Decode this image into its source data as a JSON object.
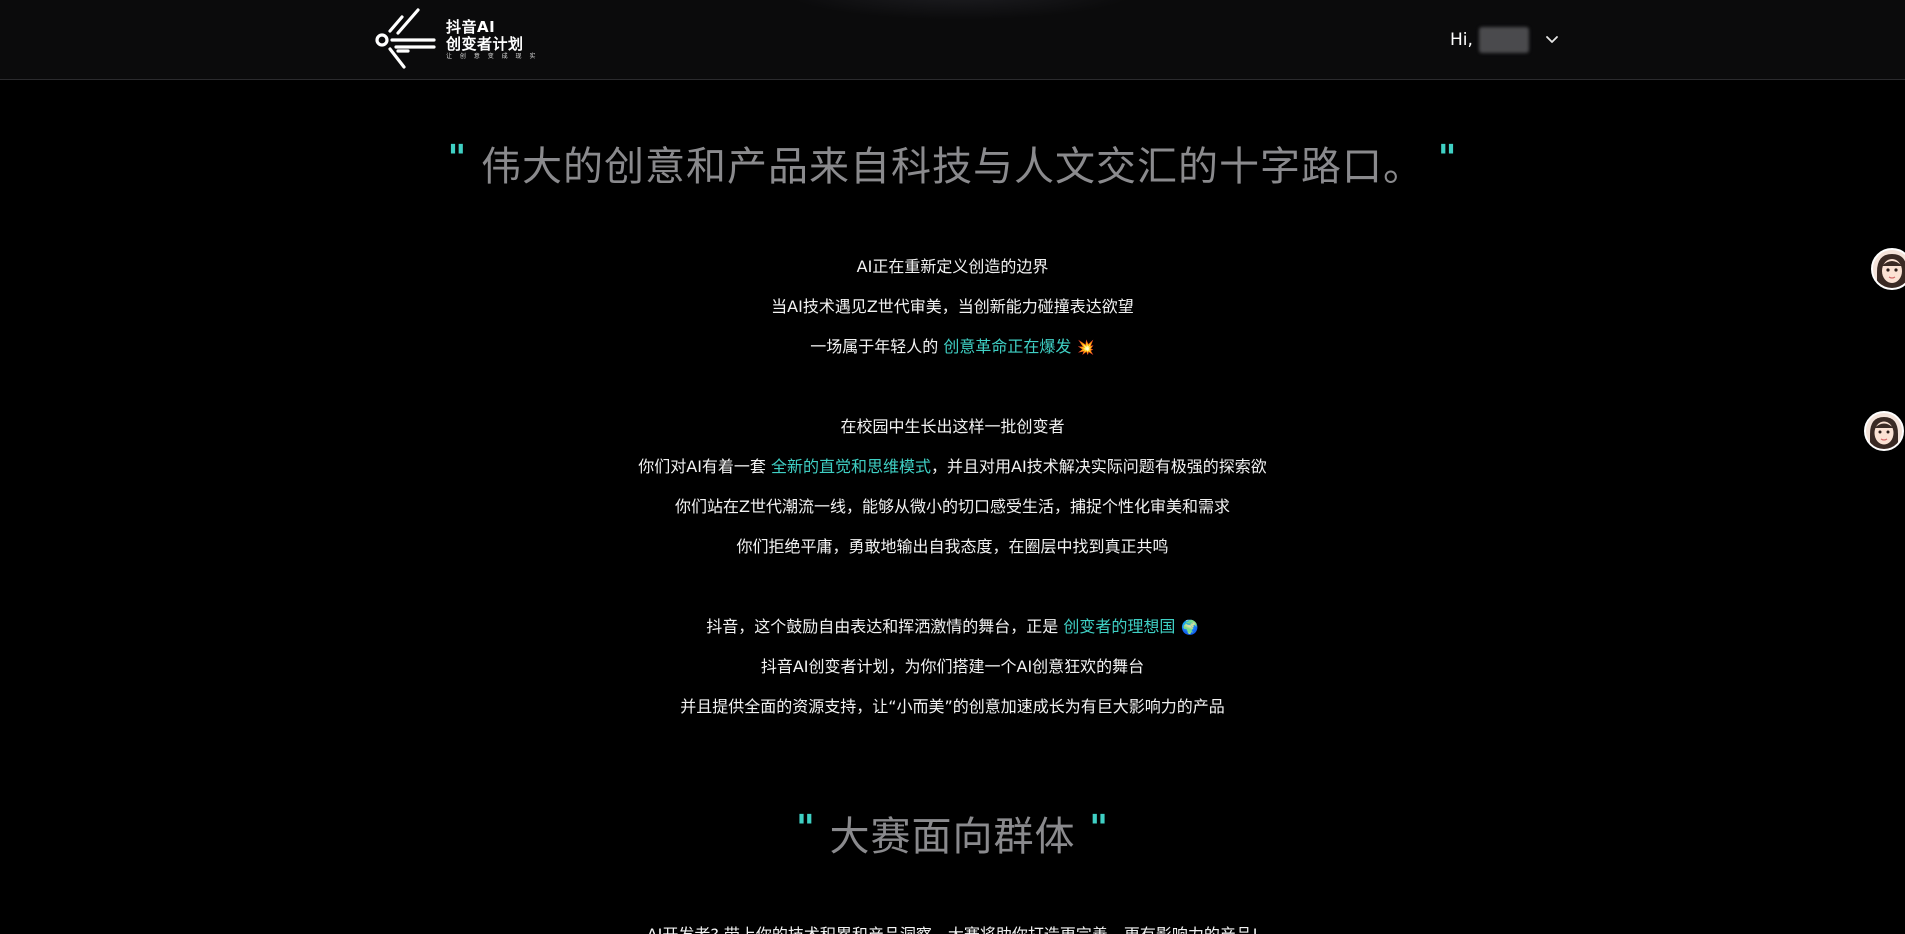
{
  "header": {
    "logo": {
      "line1": "抖音AI",
      "line2": "创变者计划",
      "sub": "让 创 意 变 成 现 实"
    },
    "greeting": "Hi,",
    "username_hidden": true,
    "dropdown_icon": "chevron-down-icon"
  },
  "hero": {
    "quote_open": "\"",
    "quote_text": "伟大的创意和产品来自科技与人文交汇的十字路口。",
    "quote_close": "\""
  },
  "intro": {
    "line1": "AI正在重新定义创造的边界",
    "line2": "当AI技术遇见Z世代审美，当创新能力碰撞表达欲望",
    "line3_prefix": "一场属于年轻人的 ",
    "line3_highlight": "创意革命正在爆发",
    "line3_emoji": "💥"
  },
  "campus": {
    "line1": "在校园中生长出这样一批创变者",
    "line2_prefix": "你们对AI有着一套 ",
    "line2_highlight": "全新的直觉和思维模式",
    "line2_suffix": "，并且对用AI技术解决实际问题有极强的探索欲",
    "line3": "你们站在Z世代潮流一线，能够从微小的切口感受生活，捕捉个性化审美和需求",
    "line4": "你们拒绝平庸，勇敢地输出自我态度，在圈层中找到真正共鸣"
  },
  "douyin": {
    "line1_prefix": "抖音，这个鼓励自由表达和挥洒激情的舞台，正是 ",
    "line1_highlight": "创变者的理想国",
    "line1_emoji": "🌍",
    "line2": "抖音AI创变者计划，为你们搭建一个AI创意狂欢的舞台",
    "line3": "并且提供全面的资源支持，让“小而美”的创意加速成长为有巨大影响力的产品"
  },
  "section2": {
    "quote_open": "\"",
    "title": "大赛面向群体",
    "quote_close": "\"",
    "partial_line": "AI开发者? 带上你的技术积累和产品洞察，大赛将助你打造更完善、更有影响力的产品!"
  },
  "colors": {
    "accent": "#3fd0c4",
    "background": "#000000",
    "header_bg": "#0b0b0c",
    "quote_text": "#8a8a8d"
  },
  "floating": {
    "avatar1_icon": "assistant-avatar-icon",
    "avatar2_icon": "assistant-avatar-icon"
  }
}
